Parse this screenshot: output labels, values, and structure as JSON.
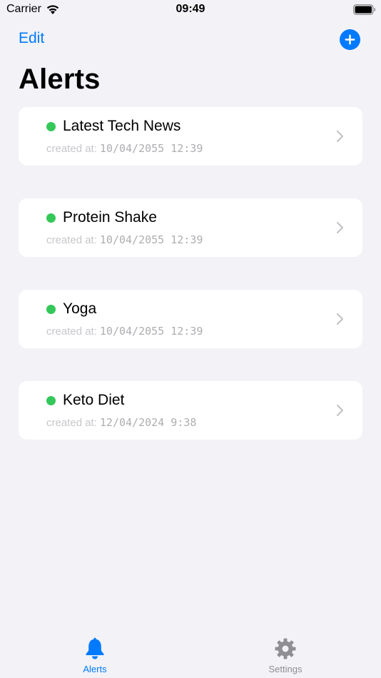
{
  "status_bar": {
    "carrier": "Carrier",
    "time": "09:49",
    "icons": [
      "wifi-icon",
      "battery-icon"
    ]
  },
  "nav": {
    "edit_label": "Edit",
    "add_icon": "plus-circle-icon",
    "title": "Alerts"
  },
  "colors": {
    "accent": "#007AFF",
    "active_dot": "#34C759",
    "background": "#F2F2F7",
    "card": "#FFFFFF"
  },
  "alerts": [
    {
      "title": "Latest Tech News",
      "created_label": "created at:",
      "created_value": "10/04/2055 12:39",
      "status": "active"
    },
    {
      "title": "Protein Shake",
      "created_label": "created at:",
      "created_value": "10/04/2055 12:39",
      "status": "active"
    },
    {
      "title": "Yoga",
      "created_label": "created at:",
      "created_value": "10/04/2055 12:39",
      "status": "active"
    },
    {
      "title": "Keto Diet",
      "created_label": "created at:",
      "created_value": "12/04/2024 9:38",
      "status": "active"
    }
  ],
  "tab_bar": {
    "tabs": [
      {
        "label": "Alerts",
        "icon": "bell-icon",
        "selected": true
      },
      {
        "label": "Settings",
        "icon": "gear-icon",
        "selected": false
      }
    ]
  }
}
